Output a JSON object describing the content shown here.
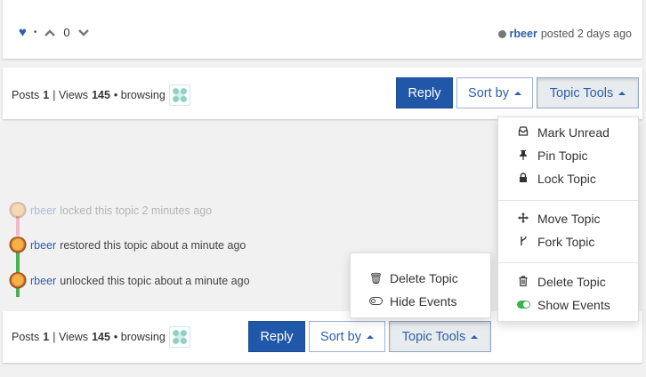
{
  "post": {
    "vote_count": "0",
    "author": "rbeer",
    "posted_text": "posted 2 days ago",
    "separator": "•",
    "icons": {
      "heart": "heart-icon",
      "upvote": "chevron-up-icon",
      "downvote": "chevron-down-icon"
    }
  },
  "stats_top": {
    "posts_label": "Posts",
    "posts_count": "1",
    "views_label": "| Views",
    "views_count": "145",
    "browsing_label": "• browsing"
  },
  "stats_bottom": {
    "posts_label": "Posts",
    "posts_count": "1",
    "views_label": "| Views",
    "views_count": "145",
    "browsing_label": "• browsing"
  },
  "toolbar": {
    "reply_label": "Reply",
    "sort_label": "Sort by",
    "tools_label": "Topic Tools"
  },
  "events": [
    {
      "user": "rbeer",
      "text": "locked this topic 2 minutes ago"
    },
    {
      "user": "rbeer",
      "text": "restored this topic about a minute ago"
    },
    {
      "user": "rbeer",
      "text": "unlocked this topic about a minute ago"
    }
  ],
  "topic_tools_menu": {
    "items": [
      {
        "label": "Mark Unread",
        "icon": "inbox-icon"
      },
      {
        "label": "Pin Topic",
        "icon": "thumbtack-icon"
      },
      {
        "label": "Lock Topic",
        "icon": "lock-icon"
      },
      {
        "label": "Move Topic",
        "icon": "move-arrows-icon"
      },
      {
        "label": "Fork Topic",
        "icon": "code-fork-icon"
      },
      {
        "label": "Delete Topic",
        "icon": "trash-icon"
      },
      {
        "label": "Show Events",
        "icon": "toggle-on-icon"
      }
    ]
  },
  "bottom_menu": {
    "items": [
      {
        "label": "Delete Topic",
        "icon": "trash-icon"
      },
      {
        "label": "Hide Events",
        "icon": "toggle-off-icon"
      }
    ]
  },
  "colors": {
    "primary": "#2157a8",
    "link": "#2b5fad",
    "toggle_on": "#3cb34a"
  }
}
